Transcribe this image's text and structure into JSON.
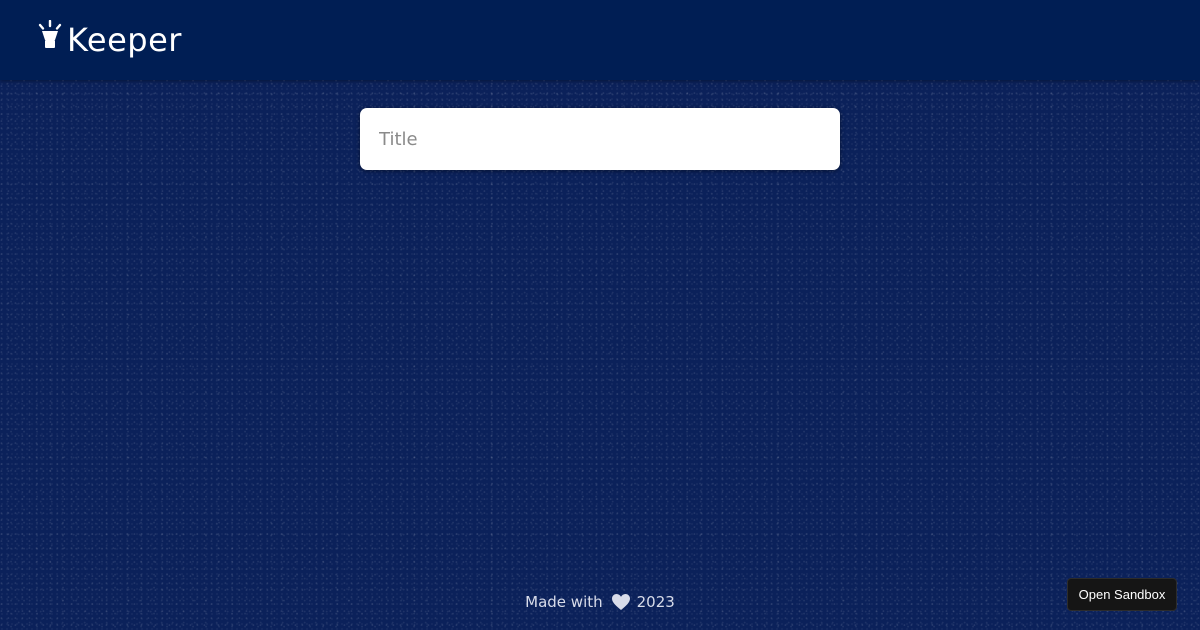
{
  "header": {
    "brand_name": "Keeper",
    "brand_icon": "lightbulb-icon"
  },
  "note_form": {
    "title_placeholder": "Title",
    "title_value": ""
  },
  "footer": {
    "made_with": "Made with",
    "heart_icon": "heart-icon",
    "year": "2023"
  },
  "sandbox": {
    "label": "Open Sandbox"
  },
  "colors": {
    "background": "#0b215a",
    "header": "#001e54",
    "input_background": "#ffffff",
    "sandbox_button": "#151515"
  }
}
